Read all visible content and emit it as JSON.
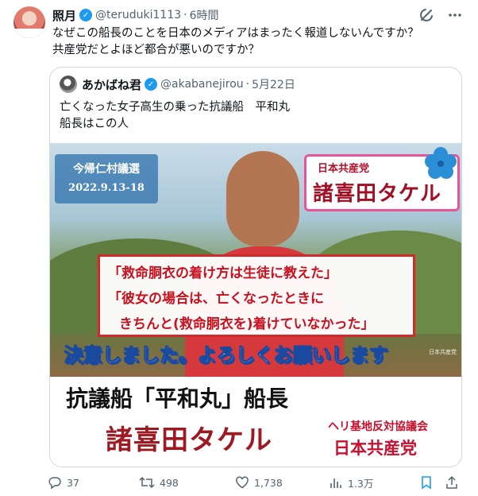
{
  "tweet": {
    "author_name": "照月",
    "handle": "@teruduki1113",
    "time": "6時間",
    "text_line1": "なぜこの船長のことを日本のメディアはまったく報道しないんですか？",
    "text_line2": "共産党だとよほど都合が悪いのですか？"
  },
  "quote": {
    "author_name": "あかばね君",
    "handle": "@akabanejirou",
    "time": "5月22日",
    "text_line1": "亡くなった女子高生の乗った抗議船　平和丸",
    "text_line2": "船長はこの人"
  },
  "image": {
    "badge_line1": "今帰仁村議選",
    "badge_line2": "2022.9.13-18",
    "party_small": "日本共産党",
    "party_name": "諸喜田タケル",
    "quote_line1": "「救命胴衣の着け方は生徒に教えた」",
    "quote_line2": "「彼女の場合は、亡くなったときに",
    "quote_line3": "きちんと(救命胴衣を)着けていなかった」",
    "caption": "決意しました。よろしくお願いします",
    "corner_mark": "日本共産党",
    "banner_title": "抗議船「平和丸」船長",
    "banner_name": "諸喜田タケル",
    "banner_org": "ヘリ基地反対協議会",
    "banner_party": "日本共産党"
  },
  "actions": {
    "replies": "37",
    "retweets": "498",
    "likes": "1,738",
    "views": "1.3万"
  },
  "icons": {
    "verified": "verified-badge-icon",
    "grok": "grok-icon",
    "more": "more-icon",
    "reply": "reply-icon",
    "retweet": "retweet-icon",
    "like": "like-icon",
    "views": "views-icon",
    "bookmark": "bookmark-icon",
    "share": "share-icon"
  },
  "colors": {
    "accent": "#1d9bf0",
    "muted": "#536471",
    "border": "#cfd9de"
  }
}
